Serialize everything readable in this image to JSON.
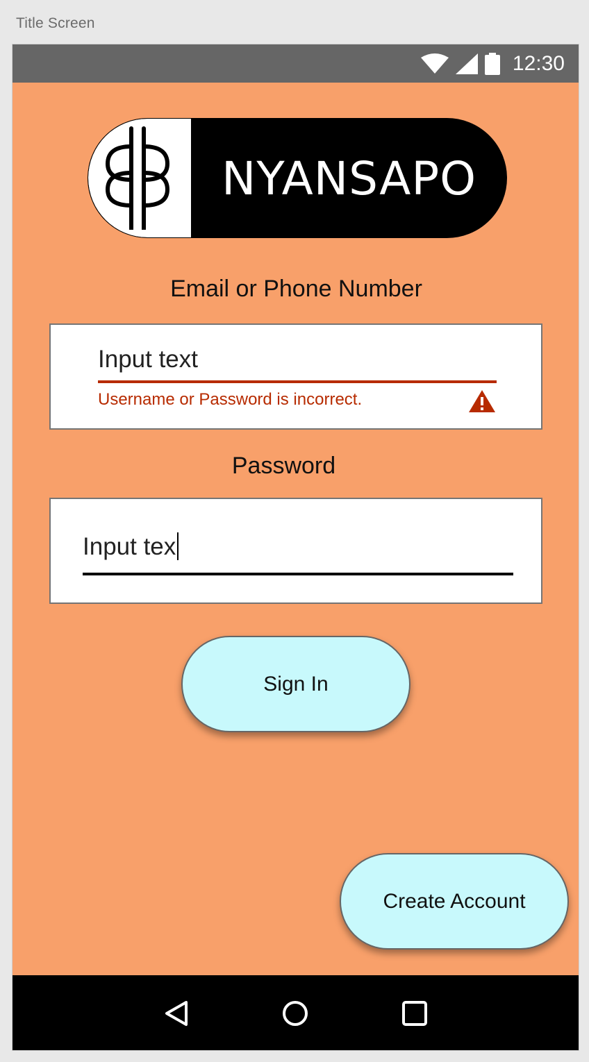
{
  "frame": {
    "title": "Title Screen"
  },
  "status_bar": {
    "time": "12:30",
    "icons": [
      "wifi-icon",
      "signal-icon",
      "battery-icon"
    ]
  },
  "logo": {
    "text": "NYANSAPO"
  },
  "email": {
    "label": "Email or Phone Number",
    "value": "Input text",
    "error": "Username or Password is incorrect.",
    "error_color": "#b72b00"
  },
  "password": {
    "label": "Password",
    "value": "Input tex"
  },
  "buttons": {
    "sign_in": "Sign In",
    "create_account": "Create Account"
  },
  "nav_bar": {
    "icons": [
      "back-icon",
      "home-icon",
      "recents-icon"
    ]
  },
  "colors": {
    "background": "#f8a06a",
    "button": "#c8f9fc",
    "status_bar": "#666666"
  }
}
